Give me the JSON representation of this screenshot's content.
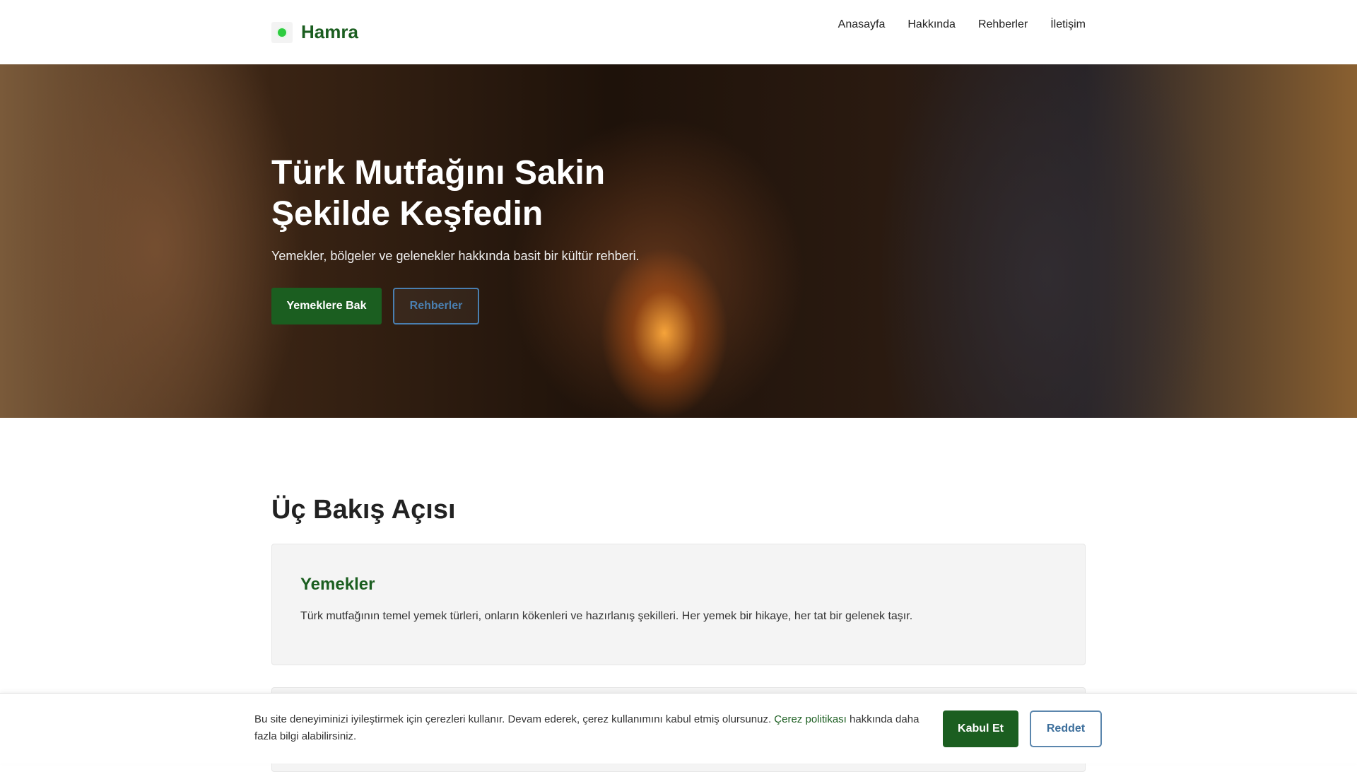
{
  "header": {
    "brand": "Hamra",
    "nav": [
      "Anasayfa",
      "Hakkında",
      "Rehberler",
      "İletişim"
    ]
  },
  "hero": {
    "title_line1": "Türk Mutfağını Sakin",
    "title_line2": "Şekilde Keşfedin",
    "subtitle": "Yemekler, bölgeler ve gelenekler hakkında basit bir kültür rehberi.",
    "primary_button": "Yemeklere Bak",
    "secondary_button": "Rehberler"
  },
  "section": {
    "title": "Üç Bakış Açısı",
    "cards": [
      {
        "title": "Yemekler",
        "text": "Türk mutfağının temel yemek türleri, onların kökenleri ve hazırlanış şekilleri. Her yemek bir hikaye, her tat bir gelenek taşır."
      }
    ]
  },
  "cookie": {
    "text_before": "Bu site deneyiminizi iyileştirmek için çerezleri kullanır. Devam ederek, çerez kullanımını kabul etmiş olursunuz. ",
    "link": "Çerez politikası",
    "text_after": " hakkında daha fazla bilgi alabilirsiniz.",
    "accept": "Kabul Et",
    "reject": "Reddet"
  }
}
